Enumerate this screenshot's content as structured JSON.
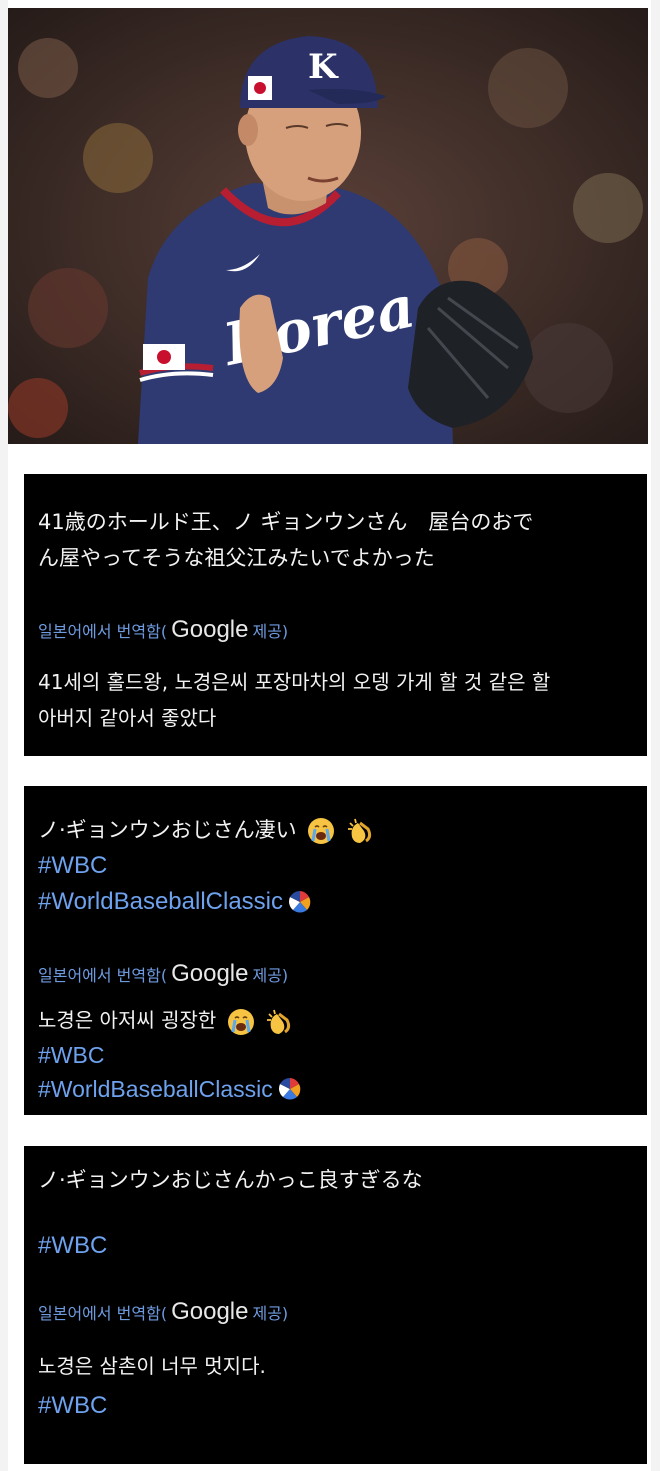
{
  "photo": {
    "cap_letter": "K",
    "jersey_text": "Korea"
  },
  "cards": [
    {
      "original": "41歳のホールド王、ノ ギョンウンさん　屋台のおでん屋やってそうな祖父江みたいでよかった",
      "original_lines": [
        "41歳のホールド王、ノ ギョンウンさん　屋台のおで",
        "ん屋やってそうな祖父江みたいでよかった"
      ],
      "translation_prefix": "일본어에서 번역함(",
      "google": "Google",
      "translation_suffix": "제공)",
      "translated_lines": [
        "41세의 홀드왕, 노경은씨 포장마차의 오뎅 가게 할 것 같은 할",
        "아버지 같아서 좋았다"
      ]
    },
    {
      "original": "ノ·ギョンウンおじさん凄い",
      "hashtags": [
        "#WBC",
        "#WorldBaseballClassic"
      ],
      "translation_prefix": "일본어에서 번역함(",
      "google": "Google",
      "translation_suffix": "제공)",
      "translated": "노경은 아저씨 굉장한",
      "translated_hashtags": [
        "#WBC",
        "#WorldBaseballClassic"
      ]
    },
    {
      "original": "ノ·ギョンウンおじさんかっこ良すぎるな",
      "hashtags": [
        "#WBC"
      ],
      "translation_prefix": "일본어에서 번역함(",
      "google": "Google",
      "translation_suffix": "제공)",
      "translated": "노경은 삼촌이 너무 멋지다.",
      "translated_hashtags": [
        "#WBC"
      ]
    }
  ],
  "colors": {
    "card_bg": "#000000",
    "hashtag": "#6ea2ee",
    "translation_label": "#6e9be0"
  }
}
